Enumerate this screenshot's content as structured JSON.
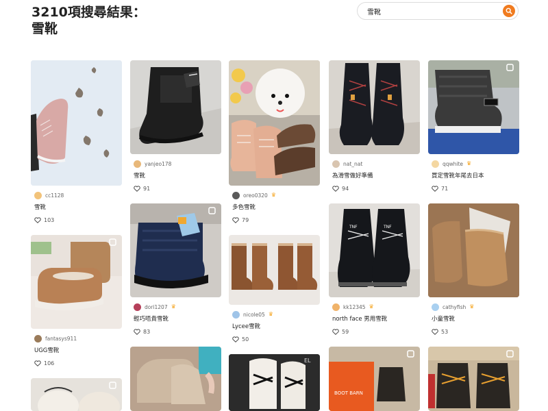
{
  "header": {
    "result_line": "3210項搜尋結果：",
    "query_line": "雪靴"
  },
  "search": {
    "value": "雪靴",
    "icon": "search-icon"
  },
  "listings": [
    {
      "username": "cc1128",
      "title": "雪靴",
      "likes": "103",
      "badge": false,
      "avatar_color": "#f2c37a"
    },
    {
      "username": "fantasys911",
      "title": "UGG雪靴",
      "likes": "106",
      "badge": false,
      "avatar_color": "#9a7b5a"
    },
    {
      "username": "yanjeo178",
      "title": "雪靴",
      "likes": "91",
      "badge": false,
      "avatar_color": "#e8b87a"
    },
    {
      "username": "dori1207",
      "title": "輕巧唔貴雪靴",
      "likes": "83",
      "badge": true,
      "avatar_color": "#b5405a"
    },
    {
      "username": "oreo0320",
      "title": "多色雪靴",
      "likes": "79",
      "badge": true,
      "avatar_color": "#5a5a5a"
    },
    {
      "username": "nicole05",
      "title": "Lycee雪靴",
      "likes": "50",
      "badge": true,
      "avatar_color": "#9fc4e8"
    },
    {
      "username": "nat_nat",
      "title": "為滑雪做好準備",
      "likes": "94",
      "badge": false,
      "avatar_color": "#d9c5b0"
    },
    {
      "username": "kk12345",
      "title": "north face 男用雪靴",
      "likes": "59",
      "badge": true,
      "avatar_color": "#f0b36a"
    },
    {
      "username": "qqwhite",
      "title": "買定雪靴年尾去日本",
      "likes": "71",
      "badge": true,
      "avatar_color": "#f4d7a1"
    },
    {
      "username": "cathyfish",
      "title": "小童雪靴",
      "likes": "53",
      "badge": true,
      "avatar_color": "#a9d0f0"
    }
  ]
}
